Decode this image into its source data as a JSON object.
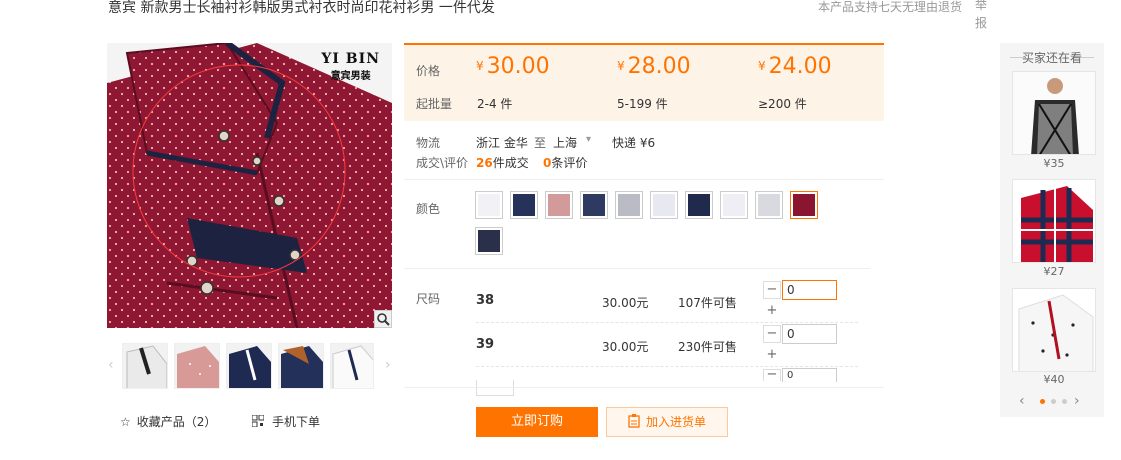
{
  "product": {
    "title": "意宾 新款男士长袖衬衫韩版男式衬衣时尚印花衬衫男 一件代发",
    "return_note": "本产品支持七天无理由退货",
    "report_label": "举报"
  },
  "brand": {
    "logo_en": "YI BIN",
    "logo_cn": "意宾男装"
  },
  "actions": {
    "favorite_label": "收藏产品（2）",
    "mobile_order_label": "手机下单",
    "buy_label": "立即订购",
    "cart_label": "加入进货单"
  },
  "pricing": {
    "price_label": "价格",
    "moq_label": "起批量",
    "currency": "¥",
    "tiers": [
      {
        "price": "30.00",
        "range": "2-4 件"
      },
      {
        "price": "28.00",
        "range": "5-199 件"
      },
      {
        "price": "24.00",
        "range": "≥200 件"
      }
    ]
  },
  "logistics": {
    "label": "物流",
    "from": "浙江 金华",
    "to_word": "至",
    "to": "上海",
    "fee": "快递 ¥6"
  },
  "deals": {
    "label": "成交\\评价",
    "deal_num": "26",
    "deal_suffix": "件成交",
    "review_num": "0",
    "review_suffix": "条评价"
  },
  "colors": {
    "label": "颜色"
  },
  "sizes": {
    "label": "尺码",
    "rows": [
      {
        "name": "38",
        "price": "30.00元",
        "stock": "107件可售",
        "qty": "0"
      },
      {
        "name": "39",
        "price": "30.00元",
        "stock": "230件可售",
        "qty": "0"
      },
      {
        "name": "",
        "price": "",
        "stock": "",
        "qty": "0"
      }
    ]
  },
  "recommend": {
    "title": "买家还在看",
    "items": [
      {
        "price": "¥35"
      },
      {
        "price": "¥27"
      },
      {
        "price": "¥40"
      }
    ]
  },
  "theme": {
    "accent": "#ff7300",
    "price_bg": "#fdf3e7",
    "shirt_red": "#8a1530"
  }
}
